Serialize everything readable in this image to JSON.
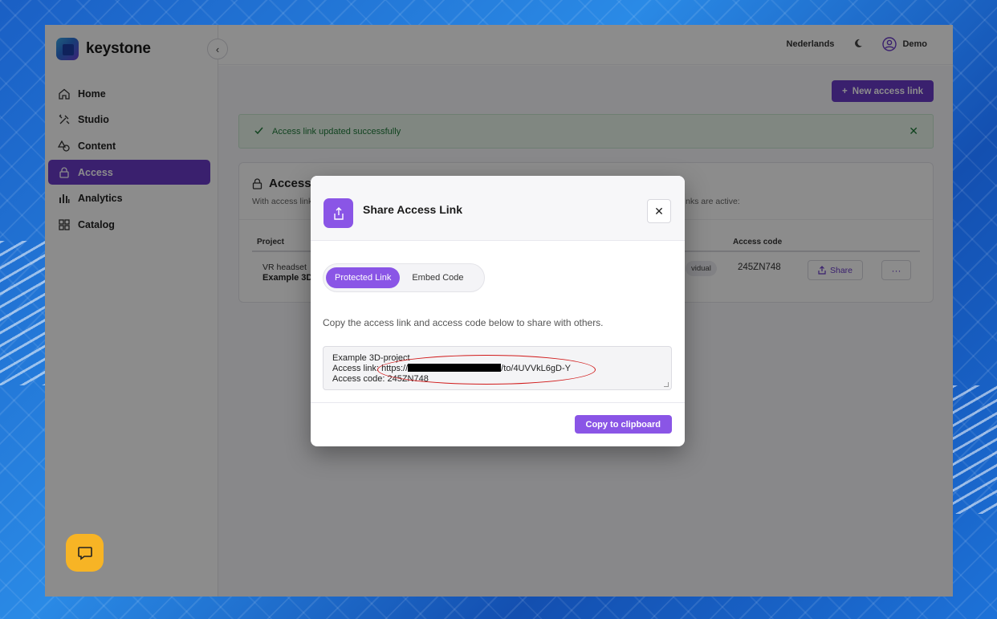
{
  "brand": {
    "name": "keystone"
  },
  "sidebar": {
    "items": [
      {
        "label": "Home",
        "icon": "home-icon"
      },
      {
        "label": "Studio",
        "icon": "tools-icon"
      },
      {
        "label": "Content",
        "icon": "shapes-icon"
      },
      {
        "label": "Access",
        "icon": "lock-icon",
        "active": true
      },
      {
        "label": "Analytics",
        "icon": "bar-chart-icon"
      },
      {
        "label": "Catalog",
        "icon": "grid-icon"
      }
    ]
  },
  "topbar": {
    "language": "Nederlands",
    "user": "Demo"
  },
  "main": {
    "new_link_label": "New access link",
    "alert": "Access link updated successfully",
    "card": {
      "title": "Access l",
      "desc": "With access link",
      "desc_right": "nks are active:",
      "columns": {
        "project": "Project",
        "access_code": "Access code"
      },
      "row": {
        "type": "VR headset",
        "name": "Example 3D",
        "badge": "vidual",
        "code": "245ZN748",
        "share_label": "Share",
        "more_label": "···"
      }
    }
  },
  "modal": {
    "title": "Share Access Link",
    "tabs": [
      {
        "label": "Protected Link",
        "active": true
      },
      {
        "label": "Embed Code"
      }
    ],
    "description": "Copy the access link and access code below to share with others.",
    "share_text": {
      "line1": "Example 3D-project",
      "line2_prefix": "Access link: https://",
      "line2_suffix": "/to/4UVVkL6gD-Y",
      "line3": "Access code: 245ZN748"
    },
    "copy_label": "Copy to clipboard"
  },
  "colors": {
    "accent": "#6a3bc9",
    "modal_accent": "#8a55e6",
    "success": "#1f7a3a",
    "chat": "#f7b425",
    "annotation": "#d11a1a"
  }
}
